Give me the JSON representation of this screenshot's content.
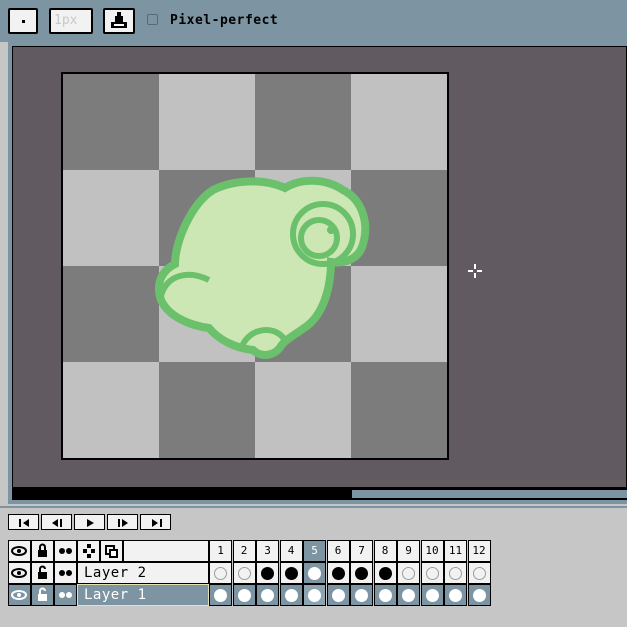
{
  "toolbar": {
    "brush_size_placeholder": "1px",
    "pixel_perfect_label": "Pixel-perfect",
    "pixel_perfect_checked": false
  },
  "colors": {
    "chrome": "#7d95a3",
    "canvas_bg": "#615a61",
    "checker_dark": "#7c7c7c",
    "checker_light": "#c1c1c1",
    "sprite_fill": "#cde7b4",
    "sprite_outline": "#6bc06b",
    "panel": "#c6c6c6"
  },
  "timeline": {
    "nav_buttons": [
      "first-frame-icon",
      "previous-frame-icon",
      "play-icon",
      "next-frame-icon",
      "last-frame-icon"
    ],
    "header_icons": [
      "eye-icon",
      "lock-icon",
      "onion-skin-icon",
      "link-cels-icon",
      "layer-options-icon"
    ],
    "frames": [
      "1",
      "2",
      "3",
      "4",
      "5",
      "6",
      "7",
      "8",
      "9",
      "10",
      "11",
      "12"
    ],
    "active_frame": "5",
    "layers": [
      {
        "name": "Layer 2",
        "selected": false,
        "cels": [
          "empty",
          "empty",
          "filled",
          "filled",
          "white",
          "filled",
          "filled",
          "filled",
          "empty",
          "empty",
          "empty",
          "empty"
        ]
      },
      {
        "name": "Layer 1",
        "selected": true,
        "cels": [
          "white",
          "white",
          "white",
          "white",
          "white",
          "white",
          "white",
          "white",
          "white",
          "white",
          "white",
          "white"
        ]
      }
    ]
  }
}
